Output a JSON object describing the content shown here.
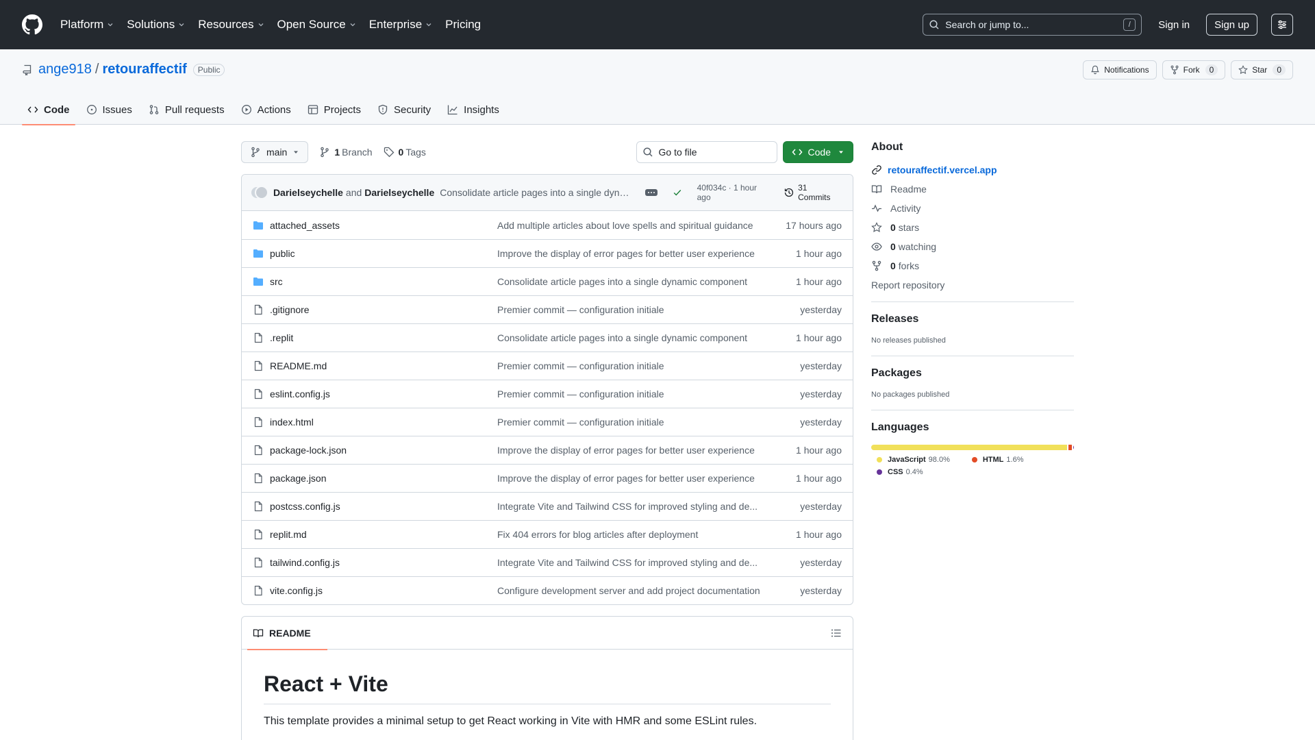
{
  "topnav": {
    "items": [
      "Platform",
      "Solutions",
      "Resources",
      "Open Source",
      "Enterprise",
      "Pricing"
    ],
    "search_placeholder": "Search or jump to...",
    "search_key": "/",
    "signin": "Sign in",
    "signup": "Sign up"
  },
  "repo": {
    "owner": "ange918",
    "sep": "/",
    "name": "retouraffectif",
    "visibility": "Public",
    "notifications": "Notifications",
    "fork_label": "Fork",
    "fork_count": "0",
    "star_label": "Star",
    "star_count": "0"
  },
  "tabs": [
    "Code",
    "Issues",
    "Pull requests",
    "Actions",
    "Projects",
    "Security",
    "Insights"
  ],
  "toolbar": {
    "branch": "main",
    "branches_count": "1",
    "branches_label": "Branch",
    "tags_count": "0",
    "tags_label": "Tags",
    "goto_placeholder": "Go to file",
    "code_button": "Code"
  },
  "commit": {
    "author1": "Darielseychelle",
    "and": "and",
    "author2": "Darielseychelle",
    "message": "Consolidate article pages into a single dynamic component",
    "sha_time": "40f034c · 1 hour ago",
    "commits": "31 Commits"
  },
  "files": [
    {
      "name": "attached_assets",
      "type": "dir",
      "commit": "Add multiple articles about love spells and spiritual guidance",
      "age": "17 hours ago"
    },
    {
      "name": "public",
      "type": "dir",
      "commit": "Improve the display of error pages for better user experience",
      "age": "1 hour ago"
    },
    {
      "name": "src",
      "type": "dir",
      "commit": "Consolidate article pages into a single dynamic component",
      "age": "1 hour ago"
    },
    {
      "name": ".gitignore",
      "type": "file",
      "commit": "Premier commit — configuration initiale",
      "age": "yesterday"
    },
    {
      "name": ".replit",
      "type": "file",
      "commit": "Consolidate article pages into a single dynamic component",
      "age": "1 hour ago"
    },
    {
      "name": "README.md",
      "type": "file",
      "commit": "Premier commit — configuration initiale",
      "age": "yesterday"
    },
    {
      "name": "eslint.config.js",
      "type": "file",
      "commit": "Premier commit — configuration initiale",
      "age": "yesterday"
    },
    {
      "name": "index.html",
      "type": "file",
      "commit": "Premier commit — configuration initiale",
      "age": "yesterday"
    },
    {
      "name": "package-lock.json",
      "type": "file",
      "commit": "Improve the display of error pages for better user experience",
      "age": "1 hour ago"
    },
    {
      "name": "package.json",
      "type": "file",
      "commit": "Improve the display of error pages for better user experience",
      "age": "1 hour ago"
    },
    {
      "name": "postcss.config.js",
      "type": "file",
      "commit": "Integrate Vite and Tailwind CSS for improved styling and de...",
      "age": "yesterday"
    },
    {
      "name": "replit.md",
      "type": "file",
      "commit": "Fix 404 errors for blog articles after deployment",
      "age": "1 hour ago"
    },
    {
      "name": "tailwind.config.js",
      "type": "file",
      "commit": "Integrate Vite and Tailwind CSS for improved styling and de...",
      "age": "yesterday"
    },
    {
      "name": "vite.config.js",
      "type": "file",
      "commit": "Configure development server and add project documentation",
      "age": "yesterday"
    }
  ],
  "readme": {
    "tab": "README",
    "h1": "React + Vite",
    "p": "This template provides a minimal setup to get React working in Vite with HMR and some ESLint rules."
  },
  "sidebar": {
    "about_title": "About",
    "website": "retouraffectif.vercel.app",
    "readme": "Readme",
    "activity": "Activity",
    "stars_count": "0",
    "stars_label": "stars",
    "watching_count": "0",
    "watching_label": "watching",
    "forks_count": "0",
    "forks_label": "forks",
    "report": "Report repository",
    "releases_title": "Releases",
    "releases_empty": "No releases published",
    "packages_title": "Packages",
    "packages_empty": "No packages published",
    "languages_title": "Languages",
    "languages": [
      {
        "name": "JavaScript",
        "pct": "98.0%",
        "value": 98.0,
        "color": "#f1e05a"
      },
      {
        "name": "HTML",
        "pct": "1.6%",
        "value": 1.6,
        "color": "#e34c26"
      },
      {
        "name": "CSS",
        "pct": "0.4%",
        "value": 0.4,
        "color": "#663399"
      }
    ]
  },
  "colors": {
    "header_bg": "#24292f",
    "link": "#0969da",
    "code_button": "#1f883d",
    "folder": "#54aeff",
    "active_tab": "#fd8c73"
  }
}
